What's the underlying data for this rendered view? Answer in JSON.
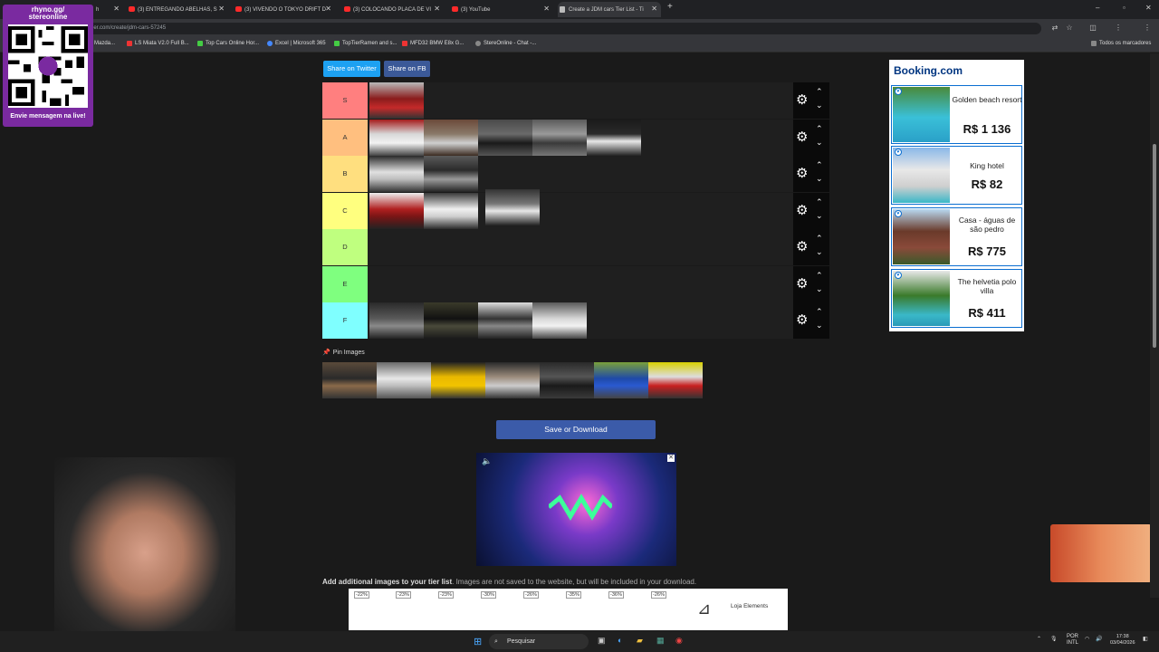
{
  "browser": {
    "tabs": [
      {
        "label": "h"
      },
      {
        "label": "(3) ENTREGANDO ABELHAS, S"
      },
      {
        "label": "(3) VIVENDO O TOKYO DRIFT D"
      },
      {
        "label": "(3) COLOCANDO PLACA DE VI"
      },
      {
        "label": "(3) YouTube"
      },
      {
        "label": "Create a JDM cars Tier List - Ti"
      }
    ],
    "url": "ler.com/create/jdm-cars-57245",
    "bookmarks": [
      {
        "label": "Mazda..."
      },
      {
        "label": "LS Miata V2.0 Full B..."
      },
      {
        "label": "Top Cars Online Hor..."
      },
      {
        "label": "Excel | Microsoft 365"
      },
      {
        "label": "TopTierRamen and s..."
      },
      {
        "label": "MFD32 BMW E8x G..."
      },
      {
        "label": "StereOnline - Chat -..."
      }
    ],
    "all_bookmarks": "Todos os marcadores"
  },
  "stream": {
    "handle": "rhyno.gg/\nstereonline",
    "cta": "Envie mensagem na live!"
  },
  "share": {
    "twitter": "Share on Twitter",
    "facebook": "Share on FB"
  },
  "tiers": [
    {
      "label": "S",
      "color": "#ff7f7f"
    },
    {
      "label": "A",
      "color": "#ffbf7f"
    },
    {
      "label": "B",
      "color": "#ffdf7f"
    },
    {
      "label": "C",
      "color": "#ffff7f"
    },
    {
      "label": "D",
      "color": "#bfff7f"
    },
    {
      "label": "E",
      "color": "#7fff7f"
    },
    {
      "label": "F",
      "color": "#7fffff"
    }
  ],
  "pin_images": "Pin Images",
  "save_button": "Save or Download",
  "bottom_note": {
    "bold": "Add additional images to your tier list",
    "rest": ". Images are not saved to the website, but will be included in your download."
  },
  "booking": {
    "logo": "Booking.com",
    "hotels": [
      {
        "name": "Golden beach resort",
        "price": "R$ 1 136"
      },
      {
        "name": "King hotel",
        "price": "R$ 82"
      },
      {
        "name": "Casa - águas de são pedro",
        "price": "R$ 775"
      },
      {
        "name": "The helvetia polo villa",
        "price": "R$ 411"
      }
    ]
  },
  "bottom_ad": {
    "discounts": [
      "-22%",
      "-23%",
      "-23%",
      "-30%",
      "-26%",
      "-35%",
      "-36%",
      "-26%"
    ],
    "brand": "Loja Elements"
  },
  "taskbar": {
    "search": "Pesquisar",
    "lang": "POR\nINTL",
    "time": "17:38",
    "date": "03/04/2026"
  }
}
